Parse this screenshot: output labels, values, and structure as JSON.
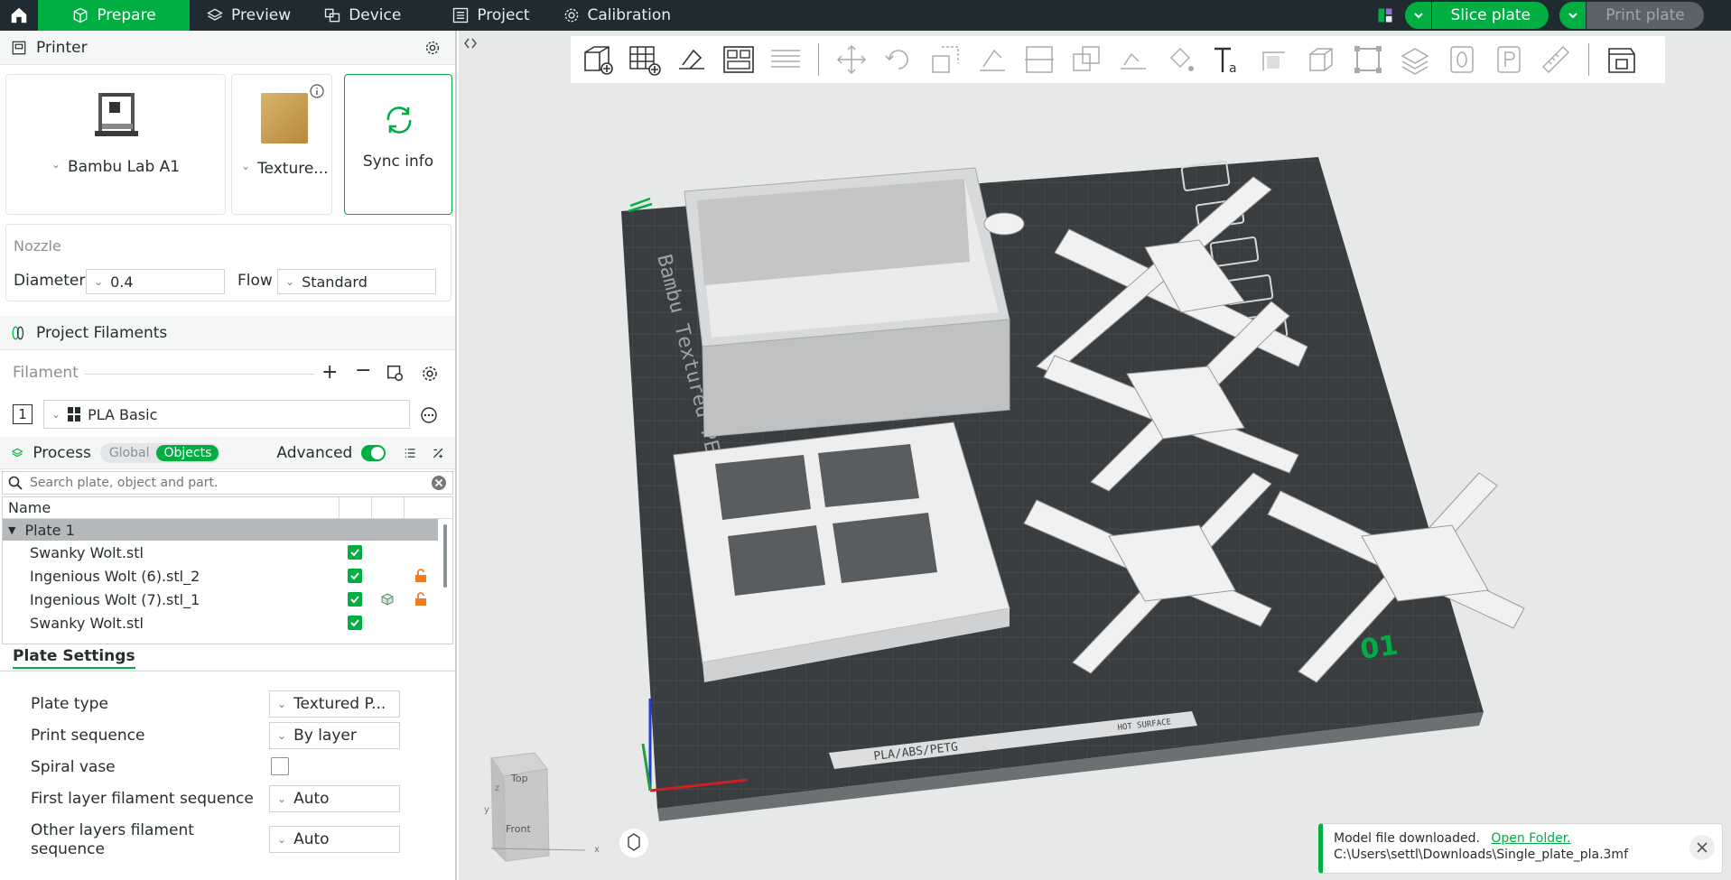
{
  "topbar": {
    "tabs": [
      {
        "label": "Prepare"
      },
      {
        "label": "Preview"
      },
      {
        "label": "Device"
      },
      {
        "label": "Project"
      },
      {
        "label": "Calibration"
      }
    ],
    "slice_label": "Slice plate",
    "print_label": "Print plate"
  },
  "printer": {
    "section_title": "Printer",
    "printer_name": "Bambu Lab A1",
    "plate_name": "Texture...",
    "sync_label": "Sync info",
    "nozzle_title": "Nozzle",
    "diameter_label": "Diameter",
    "diameter_value": "0.4",
    "flow_label": "Flow",
    "flow_value": "Standard"
  },
  "filaments": {
    "section_title": "Project Filaments",
    "filament_label": "Filament",
    "items": [
      {
        "index": "1",
        "name": "PLA Basic"
      }
    ]
  },
  "process": {
    "title": "Process",
    "toggle_global": "Global",
    "toggle_objects": "Objects",
    "advanced_label": "Advanced",
    "search_placeholder": "Search plate, object and part."
  },
  "objects": {
    "header_name": "Name",
    "plate_label": "Plate 1",
    "items": [
      {
        "name": "Swanky Wolt.stl",
        "locked": false,
        "modifier": false
      },
      {
        "name": "Ingenious Wolt (6).stl_2",
        "locked": true,
        "modifier": false
      },
      {
        "name": "Ingenious Wolt (7).stl_1",
        "locked": true,
        "modifier": true
      },
      {
        "name": "Swanky Wolt.stl",
        "locked": false,
        "modifier": false
      }
    ]
  },
  "plate_settings": {
    "tab_label": "Plate Settings",
    "plate_type_label": "Plate type",
    "plate_type_value": "Textured P...",
    "print_sequence_label": "Print sequence",
    "print_sequence_value": "By layer",
    "spiral_vase_label": "Spiral vase",
    "first_layer_label": "First layer filament sequence",
    "first_layer_value": "Auto",
    "other_layers_label": "Other layers filament sequence",
    "other_layers_value": "Auto"
  },
  "viewport": {
    "bed_label": "Bambu Textured PEI Plate",
    "plate_number": "01",
    "material_label": "PLA/ABS/PETG",
    "hot_surface": "HOT SURFACE",
    "view_cube": {
      "top": "Top",
      "front": "Front",
      "x": "x",
      "y": "y",
      "z": "z"
    }
  },
  "toast": {
    "message": "Model file downloaded.",
    "link": "Open Folder.",
    "path": "C:\\Users\\settl\\Downloads\\Single_plate_pla.3mf"
  },
  "colors": {
    "accent": "#00ae42",
    "topbar": "#1f2b31",
    "bed": "#3a3d3f"
  }
}
